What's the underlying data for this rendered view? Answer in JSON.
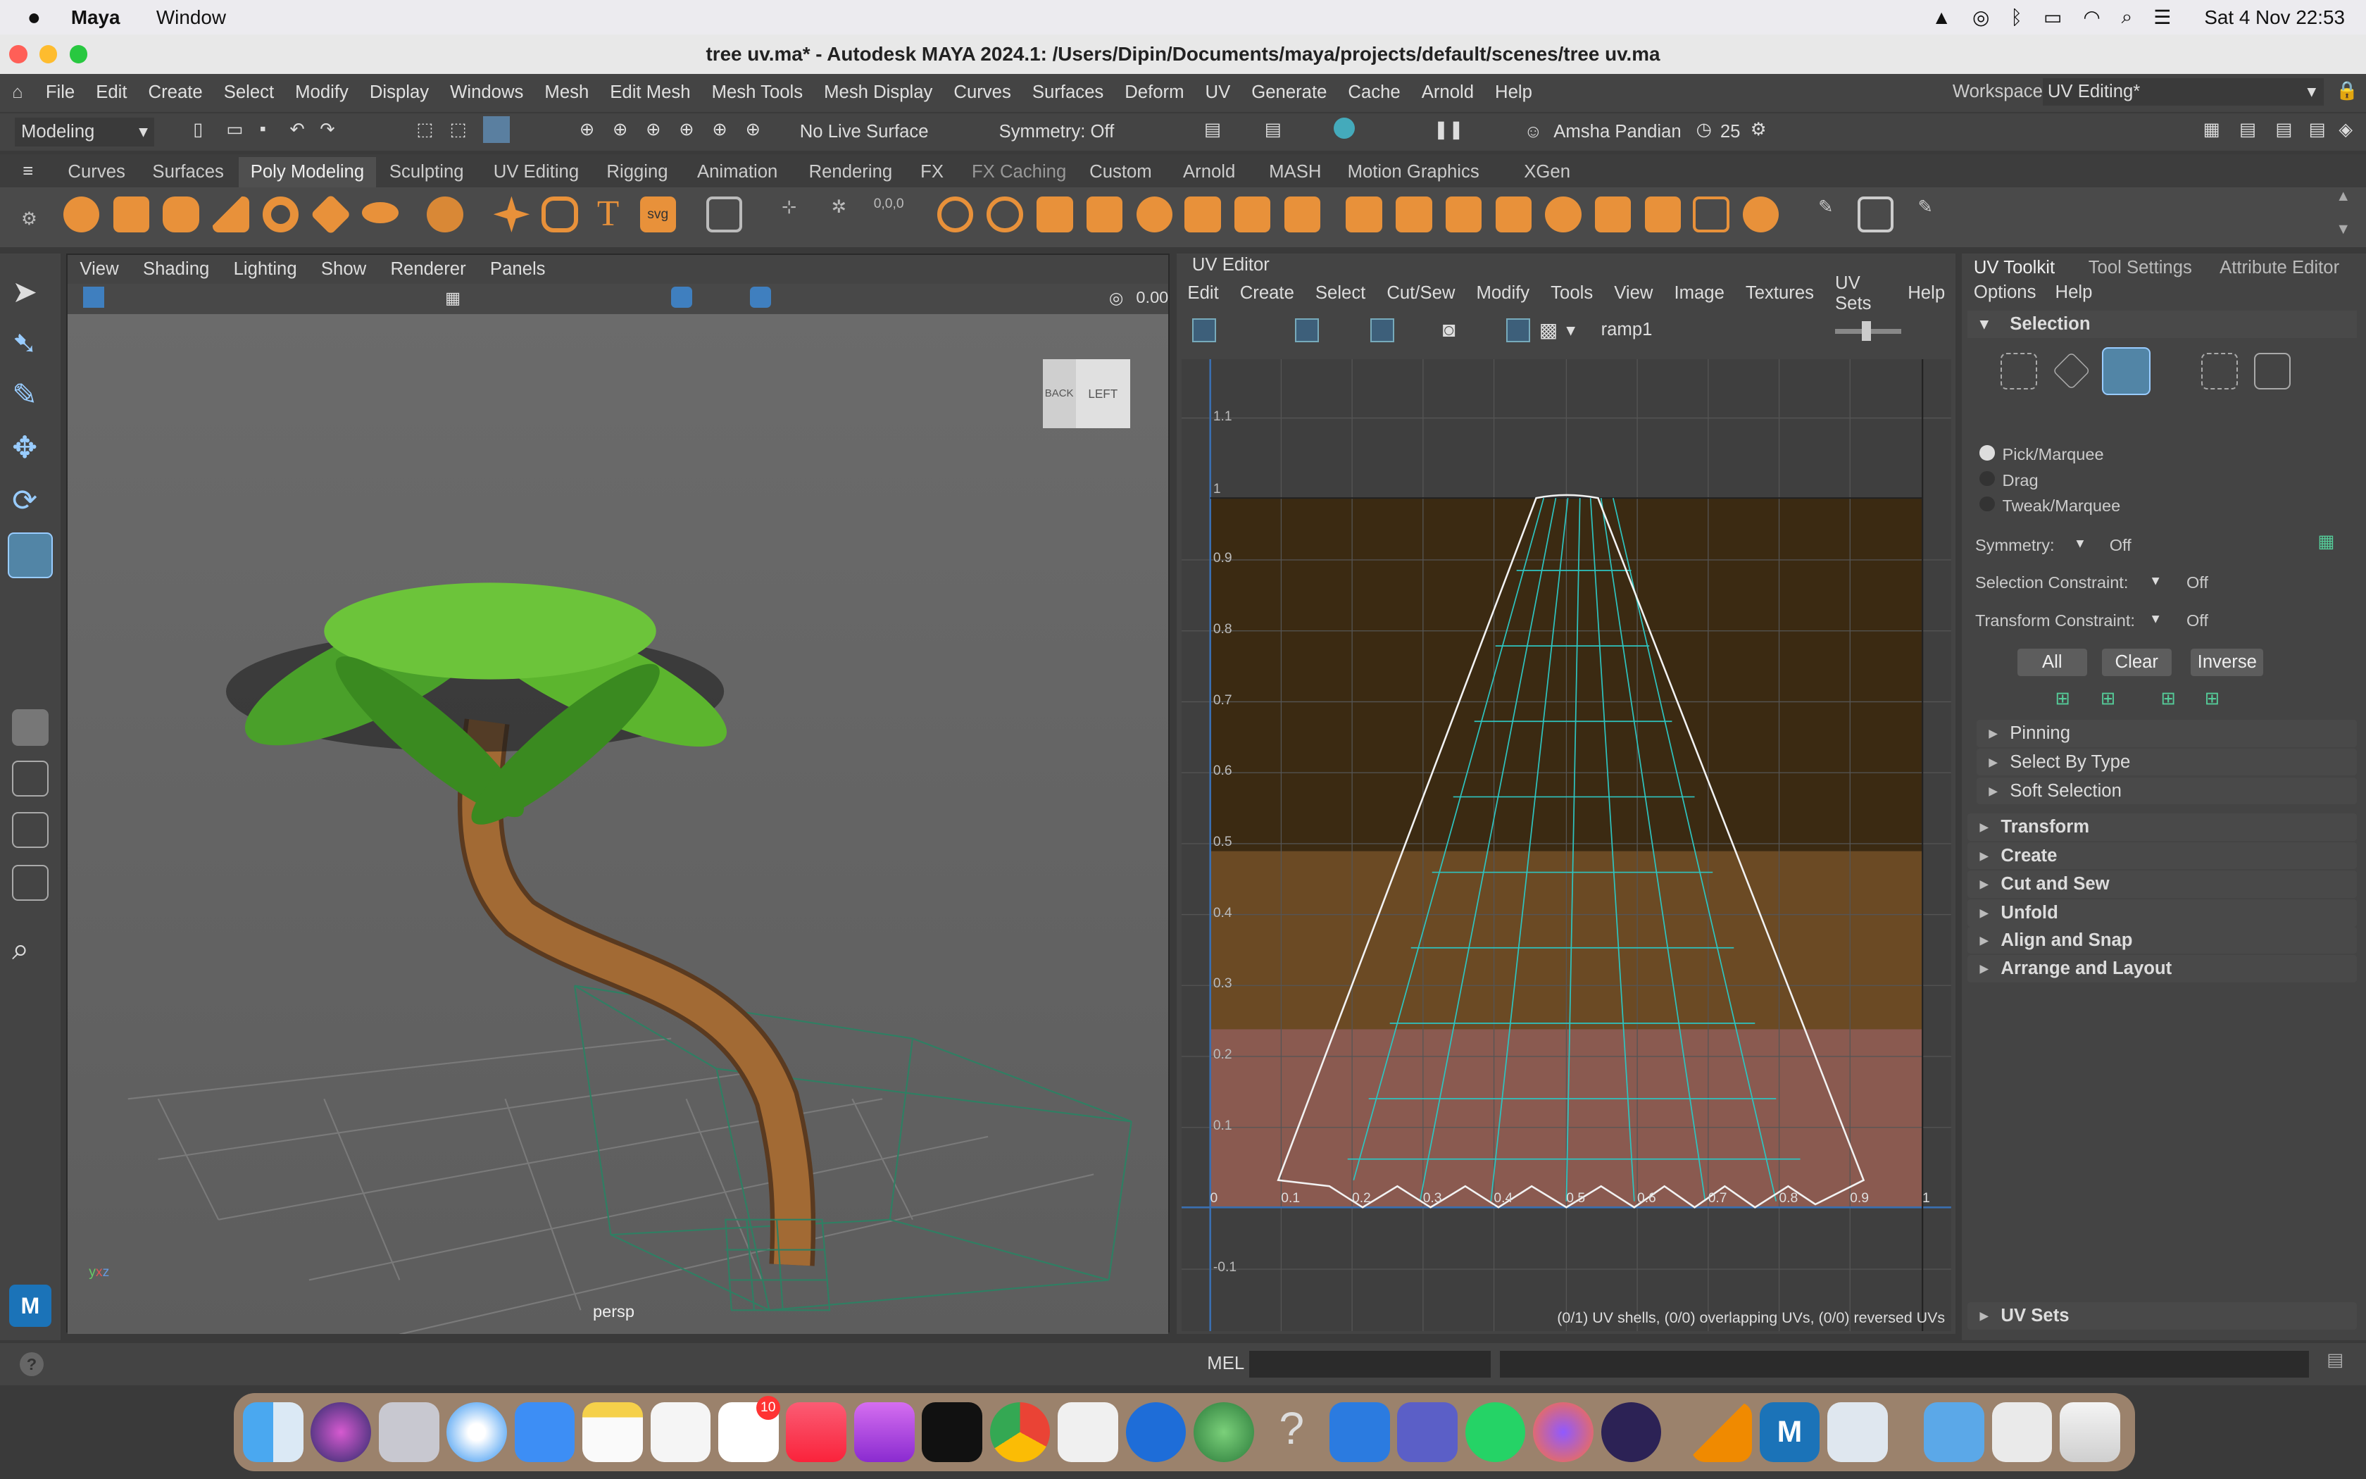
{
  "macbar": {
    "app": "Maya",
    "menus": [
      "Window"
    ],
    "clock": "Sat 4 Nov  22:53"
  },
  "window": {
    "title": "tree uv.ma* - Autodesk MAYA 2024.1: /Users/Dipin/Documents/maya/projects/default/scenes/tree uv.ma"
  },
  "main_menu": [
    "File",
    "Edit",
    "Create",
    "Select",
    "Modify",
    "Display",
    "Windows",
    "Mesh",
    "Edit Mesh",
    "Mesh Tools",
    "Mesh Display",
    "Curves",
    "Surfaces",
    "Deform",
    "UV",
    "Generate",
    "Cache",
    "Arnold",
    "Help"
  ],
  "workspace": {
    "label": "Workspace:",
    "value": "UV Editing*"
  },
  "status": {
    "mode": "Modeling",
    "live_surface": "No Live Surface",
    "symmetry": "Symmetry: Off",
    "user": "Amsha Pandian",
    "count": "25"
  },
  "shelf_tabs": [
    "Curves",
    "Surfaces",
    "Poly Modeling",
    "Sculpting",
    "UV Editing",
    "Rigging",
    "Animation",
    "Rendering",
    "FX",
    "FX Caching",
    "Custom",
    "Arnold",
    "MASH",
    "Motion Graphics",
    "XGen"
  ],
  "shelf_active": "Poly Modeling",
  "viewport": {
    "menus": [
      "View",
      "Shading",
      "Lighting",
      "Show",
      "Renderer",
      "Panels"
    ],
    "camera": "persp",
    "cube_back": "BACK",
    "cube_left": "LEFT",
    "field_value": "0.00"
  },
  "uv_editor": {
    "title": "UV Editor",
    "menus": [
      "Edit",
      "Create",
      "Select",
      "Cut/Sew",
      "Modify",
      "Tools",
      "View",
      "Image",
      "Textures",
      "UV Sets",
      "Help"
    ],
    "texture": "ramp1",
    "v_labels": [
      "1.1",
      "1",
      "0.9",
      "0.8",
      "0.7",
      "0.6",
      "0.5",
      "0.4",
      "0.3",
      "0.2",
      "0.1",
      "-0.1"
    ],
    "u_labels": [
      "0",
      "0.1",
      "0.2",
      "0.3",
      "0.4",
      "0.5",
      "0.6",
      "0.7",
      "0.8",
      "0.9",
      "1"
    ],
    "stats": "(0/1) UV shells, (0/0) overlapping UVs, (0/0) reversed UVs"
  },
  "right_panel": {
    "tabs": [
      "UV Toolkit",
      "Tool Settings",
      "Attribute Editor"
    ],
    "submenu": [
      "Options",
      "Help"
    ],
    "selection_header": "Selection",
    "radio": [
      "Pick/Marquee",
      "Drag",
      "Tweak/Marquee"
    ],
    "symmetry_label": "Symmetry:",
    "symmetry_value": "Off",
    "sel_constraint_label": "Selection Constraint:",
    "sel_constraint_value": "Off",
    "transform_constraint_label": "Transform Constraint:",
    "transform_constraint_value": "Off",
    "buttons": [
      "All",
      "Clear",
      "Inverse"
    ],
    "subsections": [
      "Pinning",
      "Select By Type",
      "Soft Selection"
    ],
    "sections": [
      "Transform",
      "Create",
      "Cut and Sew",
      "Unfold",
      "Align and Snap",
      "Arrange and Layout"
    ],
    "uv_sets": "UV Sets"
  },
  "command_line": {
    "lang": "MEL"
  },
  "dock": {
    "badge": "10"
  },
  "colors": {
    "accent": "#f0a020",
    "uv_grid": "#2ec4c0"
  }
}
